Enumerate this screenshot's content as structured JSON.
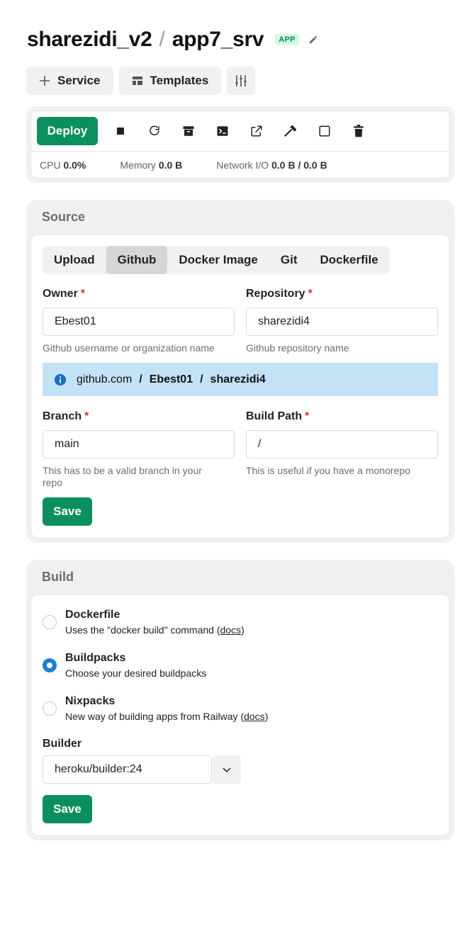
{
  "header": {
    "project": "sharezidi_v2",
    "separator": "/",
    "app_name": "app7_srv",
    "badge": "APP"
  },
  "toolbar": {
    "service_label": "Service",
    "templates_label": "Templates"
  },
  "controls": {
    "deploy_label": "Deploy",
    "stats": {
      "cpu_label": "CPU",
      "cpu_value": "0.0%",
      "memory_label": "Memory",
      "memory_value": "0.0 B",
      "network_label": "Network I/O",
      "network_value": "0.0 B / 0.0 B"
    }
  },
  "source": {
    "title": "Source",
    "tabs": [
      "Upload",
      "Github",
      "Docker Image",
      "Git",
      "Dockerfile"
    ],
    "active_tab": "Github",
    "owner": {
      "label": "Owner",
      "value": "Ebest01",
      "hint": "Github username or organization name"
    },
    "repository": {
      "label": "Repository",
      "value": "sharezidi4",
      "hint": "Github repository name"
    },
    "repo_path": {
      "host": "github.com",
      "sep": "/",
      "owner": "Ebest01",
      "repo": "sharezidi4"
    },
    "branch": {
      "label": "Branch",
      "value": "main",
      "hint_line1": "This has to be a valid branch in your",
      "hint_line2": "repo"
    },
    "build_path": {
      "label": "Build Path",
      "value": "/",
      "hint": "This is useful if you have a monorepo"
    },
    "required_mark": "*",
    "save_label": "Save"
  },
  "build": {
    "title": "Build",
    "options": [
      {
        "title": "Dockerfile",
        "desc_before": "Uses the \"docker build\" command (",
        "desc_link": "docs",
        "desc_after": ")",
        "checked": false
      },
      {
        "title": "Buildpacks",
        "desc_before": "Choose your desired buildpacks",
        "desc_link": "",
        "desc_after": "",
        "checked": true
      },
      {
        "title": "Nixpacks",
        "desc_before": "New way of building apps from Railway (",
        "desc_link": "docs",
        "desc_after": ")",
        "checked": false
      }
    ],
    "builder_label": "Builder",
    "builder_value": "heroku/builder:24",
    "save_label": "Save"
  },
  "colors": {
    "accent_green": "#0b8f5f",
    "badge_bg": "#d3f9e4",
    "info_bg": "#c3e2f6",
    "radio_checked": "#1c7ed6",
    "required": "#e03131"
  },
  "icons": {
    "toolbar": [
      "plus-icon",
      "templates-icon",
      "sliders-icon"
    ],
    "actions": [
      "stop-icon",
      "restart-icon",
      "archive-icon",
      "terminal-icon",
      "external-link-icon",
      "hammer-icon",
      "square-icon",
      "trash-icon"
    ],
    "header": "pencil-icon",
    "info": "info-icon",
    "select": "chevron-down-icon"
  }
}
